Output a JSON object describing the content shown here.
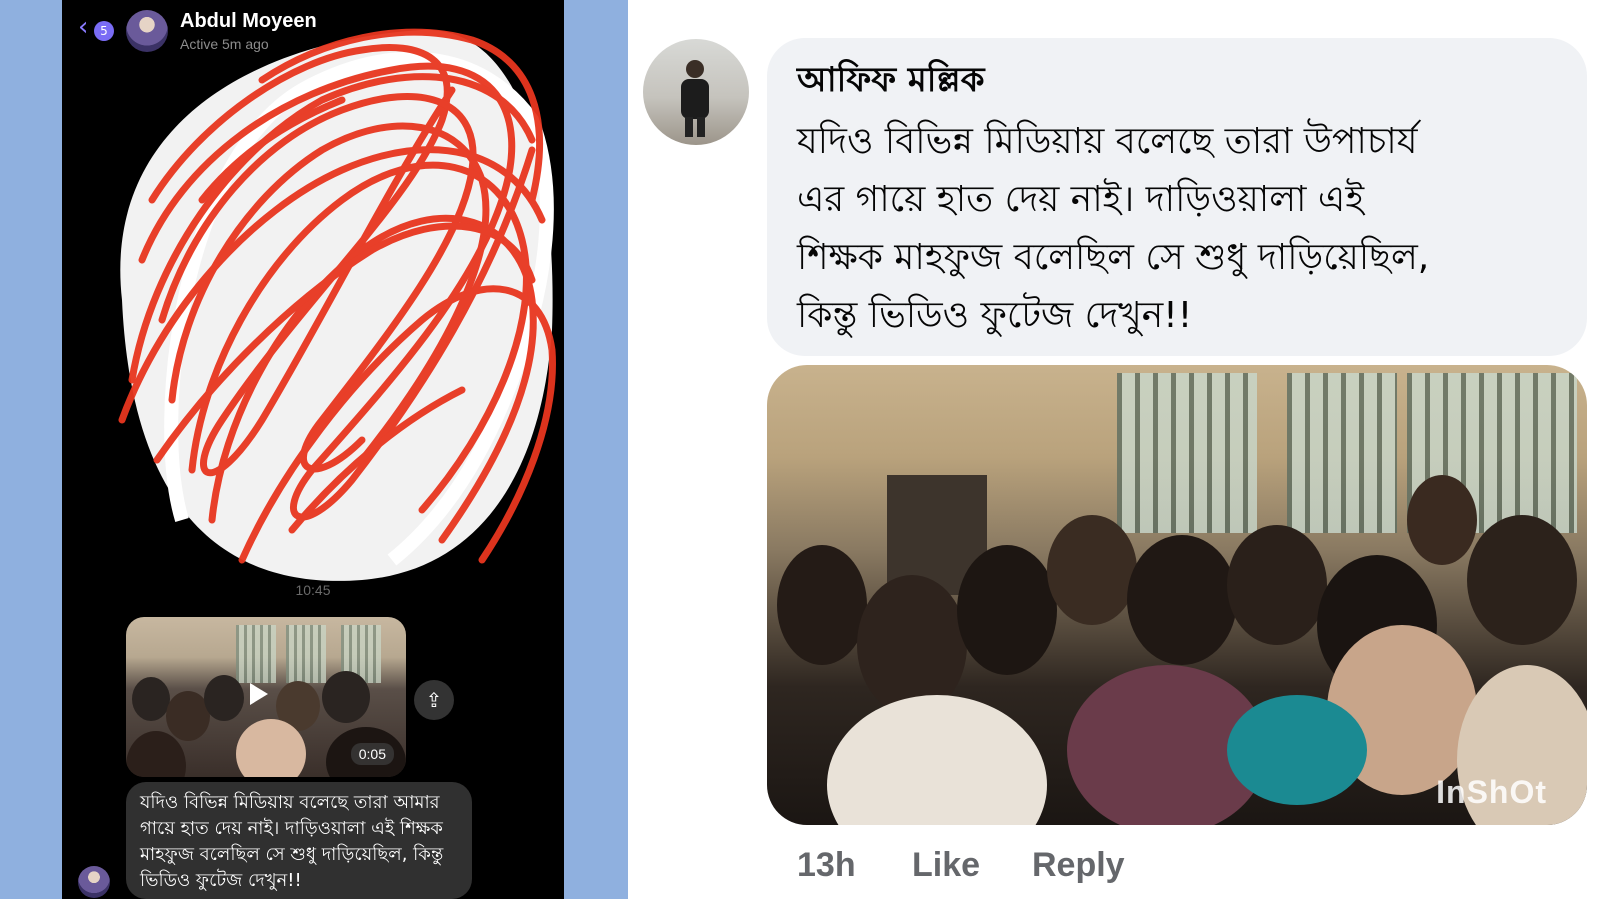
{
  "messenger": {
    "unread_count": "5",
    "contact_name": "Abdul Moyeen",
    "contact_status": "Active 5m ago",
    "message_time": "10:45",
    "video_duration": "0:05",
    "message_text": "যদিও বিভিন্ন মিডিয়ায় বলেছে তারা আমার গায়ে হাত দেয় নাই। দাড়িওয়ালা এই শিক্ষক মাহফুজ বলেছিল সে শুধু দাড়িয়েছিল, কিন্তু ভিডিও ফুটেজ দেখুন!!",
    "back_icon": "chevron-left-icon",
    "share_icon": "share-icon",
    "scribble_color": "#e8361f"
  },
  "facebook_comment": {
    "author": "আফিফ মল্লিক",
    "lines": [
      "যদিও বিভিন্ন মিডিয়ায় বলেছে তারা উপাচার্য",
      "এর গায়ে হাত দেয় নাই। দাড়িওয়ালা এই",
      "শিক্ষক মাহফুজ বলেছিল সে শুধু দাড়িয়েছিল,",
      "কিন্তু ভিডিও ফুটেজ দেখুন!!"
    ],
    "video_watermark": "InShOt",
    "timestamp": "13h",
    "like_label": "Like",
    "reply_label": "Reply"
  },
  "colors": {
    "backdrop": "#8fb0df",
    "bubble": "#f0f2f5",
    "action_text": "#65676b"
  }
}
